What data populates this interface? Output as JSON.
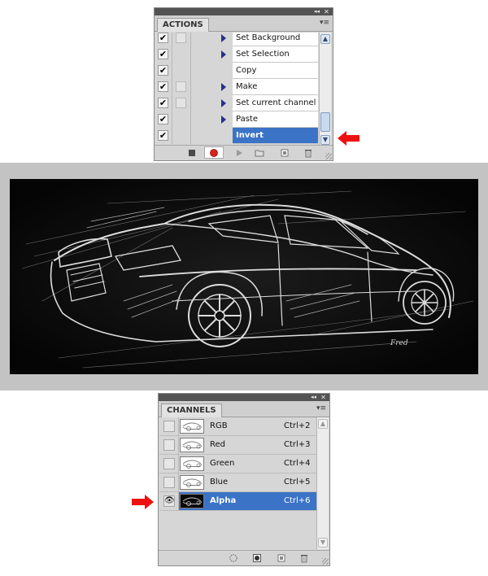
{
  "actions_panel": {
    "tab_label": "ACTIONS",
    "collapse_glyph": "◂◂",
    "close_glyph": "✕",
    "menu_glyph": "▾≡",
    "rows": [
      {
        "label": "Set Background",
        "checked": true,
        "modal": true,
        "expand": true,
        "selected": false
      },
      {
        "label": "Set Selection",
        "checked": true,
        "modal": false,
        "expand": true,
        "selected": false
      },
      {
        "label": "Copy",
        "checked": true,
        "modal": false,
        "expand": false,
        "selected": false
      },
      {
        "label": "Make",
        "checked": true,
        "modal": true,
        "expand": true,
        "selected": false
      },
      {
        "label": "Set current channel",
        "checked": true,
        "modal": true,
        "expand": true,
        "selected": false
      },
      {
        "label": "Paste",
        "checked": true,
        "modal": false,
        "expand": true,
        "selected": false
      },
      {
        "label": "Invert",
        "checked": true,
        "modal": false,
        "expand": false,
        "selected": true
      }
    ],
    "check_glyph": "✔",
    "bottom_icons": [
      "stop-icon",
      "record-icon",
      "play-icon",
      "new-set-icon",
      "new-action-icon",
      "trash-icon"
    ]
  },
  "canvas": {
    "signature_text": "Fred"
  },
  "channels_panel": {
    "tab_label": "CHANNELS",
    "collapse_glyph": "◂◂",
    "close_glyph": "✕",
    "menu_glyph": "▾≡",
    "eye_glyph": "👁",
    "rows": [
      {
        "name": "RGB",
        "shortcut": "Ctrl+2",
        "visible": false,
        "selected": false
      },
      {
        "name": "Red",
        "shortcut": "Ctrl+3",
        "visible": false,
        "selected": false
      },
      {
        "name": "Green",
        "shortcut": "Ctrl+4",
        "visible": false,
        "selected": false
      },
      {
        "name": "Blue",
        "shortcut": "Ctrl+5",
        "visible": false,
        "selected": false
      },
      {
        "name": "Alpha",
        "shortcut": "Ctrl+6",
        "visible": true,
        "selected": true
      }
    ],
    "bottom_icons": [
      "load-selection-icon",
      "save-selection-icon",
      "new-channel-icon",
      "trash-icon"
    ]
  },
  "colors": {
    "selection": "#3b73c6",
    "arrow": "#ee1111"
  }
}
